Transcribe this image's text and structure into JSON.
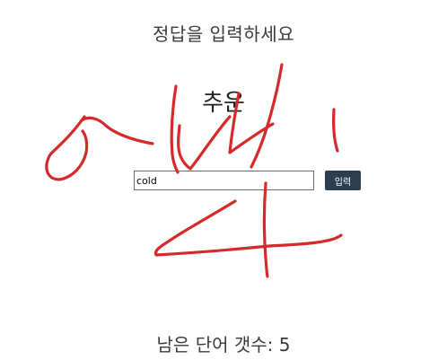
{
  "prompt": "정답을 입력하세요",
  "word": "추운",
  "answer": {
    "value": "cold"
  },
  "submit_label": "입력",
  "remaining_text": "남은 단어 갯수: 5",
  "colors": {
    "scribble": "#d42a2a",
    "button": "#2c3e50"
  }
}
